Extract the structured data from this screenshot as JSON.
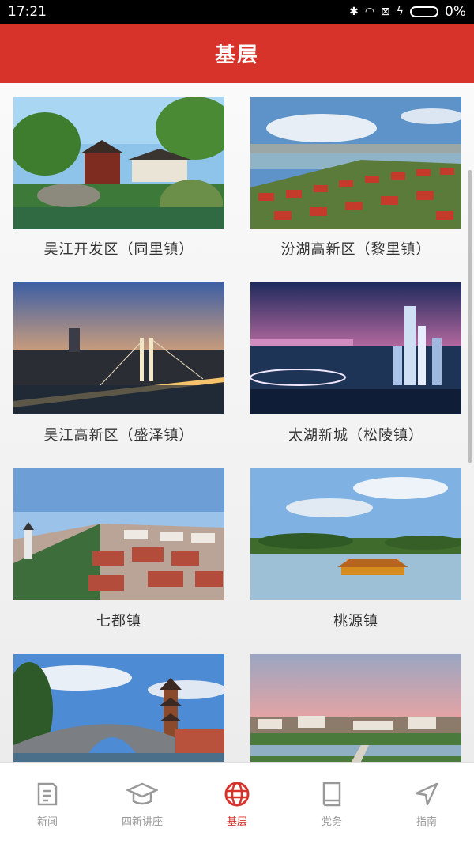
{
  "status": {
    "time": "17:21",
    "battery": "0%"
  },
  "header": {
    "title": "基层"
  },
  "items": [
    {
      "label": "吴江开发区（同里镇）",
      "scene": "garden-scene"
    },
    {
      "label": "汾湖高新区（黎里镇）",
      "scene": "lake-town-scene"
    },
    {
      "label": "吴江高新区（盛泽镇）",
      "scene": "bridge-night-scene"
    },
    {
      "label": "太湖新城（松陵镇）",
      "scene": "city-night-scene"
    },
    {
      "label": "七都镇",
      "scene": "waterfront-town-scene"
    },
    {
      "label": "桃源镇",
      "scene": "lake-boat-scene"
    },
    {
      "label": "",
      "scene": "pagoda-bridge-scene"
    },
    {
      "label": "",
      "scene": "sunset-river-scene"
    }
  ],
  "tabs": [
    {
      "label": "新闻",
      "icon": "news-icon",
      "active": false
    },
    {
      "label": "四新讲座",
      "icon": "graduation-cap-icon",
      "active": false
    },
    {
      "label": "基层",
      "icon": "globe-icon",
      "active": true
    },
    {
      "label": "党务",
      "icon": "book-icon",
      "active": false
    },
    {
      "label": "指南",
      "icon": "navigation-icon",
      "active": false
    }
  ],
  "colors": {
    "brand_red": "#d7332b",
    "tab_inactive": "#999999"
  }
}
